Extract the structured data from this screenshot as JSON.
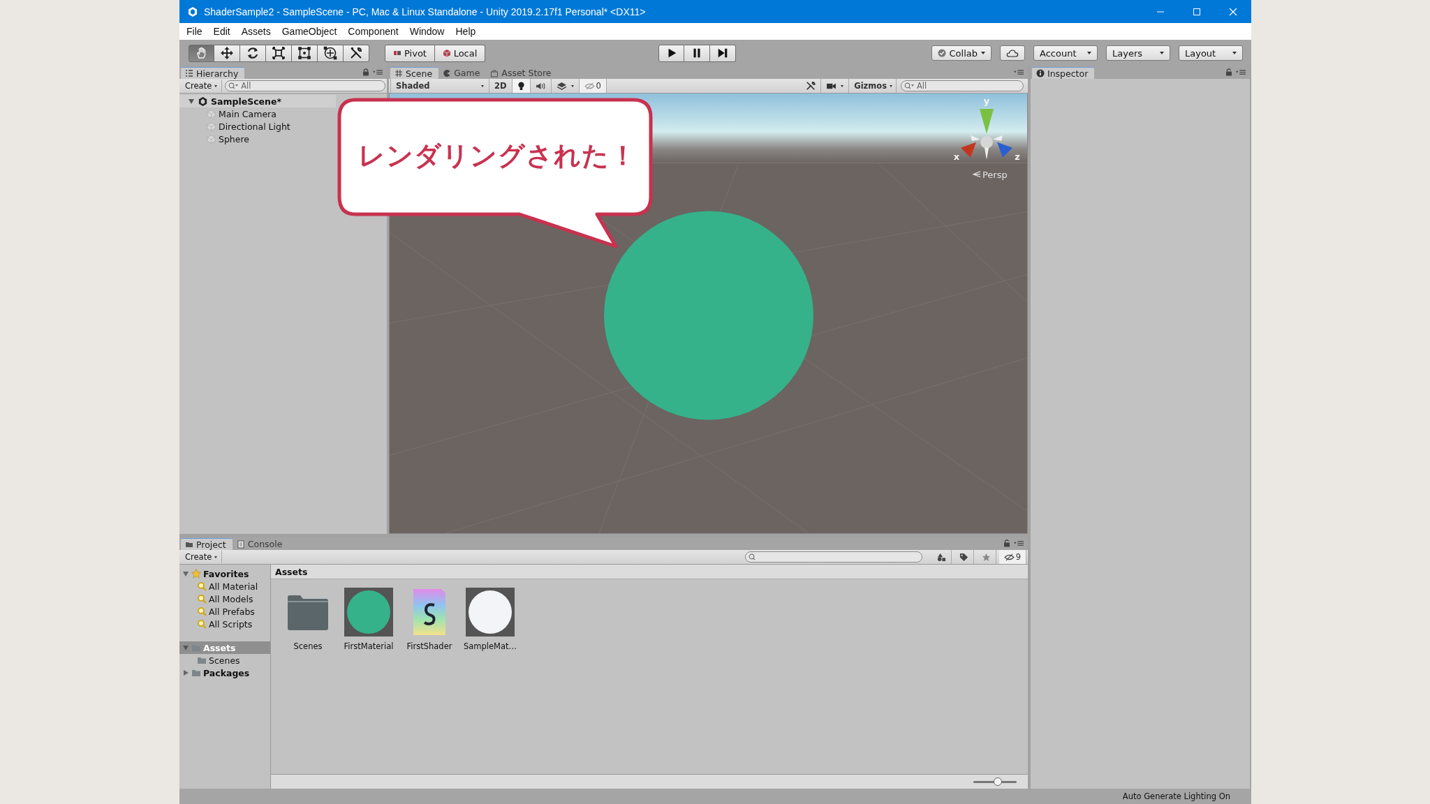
{
  "window": {
    "title": "ShaderSample2 - SampleScene - PC, Mac & Linux Standalone - Unity 2019.2.17f1 Personal* <DX11>"
  },
  "menu": [
    "File",
    "Edit",
    "Assets",
    "GameObject",
    "Component",
    "Window",
    "Help"
  ],
  "toolbar": {
    "tools": [
      {
        "kind": "hand",
        "selected": true
      },
      {
        "kind": "move",
        "selected": false
      },
      {
        "kind": "rotate",
        "selected": false
      },
      {
        "kind": "scale",
        "selected": false
      },
      {
        "kind": "rect",
        "selected": false
      },
      {
        "kind": "transform",
        "selected": false
      },
      {
        "kind": "custom",
        "selected": false
      }
    ],
    "pivot": "Pivot",
    "space": "Local",
    "collab": "Collab",
    "account": "Account",
    "layers": "Layers",
    "layout": "Layout"
  },
  "hierarchy": {
    "tab": "Hierarchy",
    "create": "Create",
    "search_placeholder": "All",
    "scene": {
      "name": "SampleScene*",
      "expanded": true,
      "children": [
        {
          "name": "Main Camera"
        },
        {
          "name": "Directional Light"
        },
        {
          "name": "Sphere"
        }
      ]
    }
  },
  "scene_view": {
    "tabs": [
      {
        "label": "Scene",
        "kind": "scene",
        "selected": true
      },
      {
        "label": "Game",
        "kind": "game",
        "selected": false
      },
      {
        "label": "Asset Store",
        "kind": "store",
        "selected": false
      }
    ],
    "shading": "Shaded",
    "mode_2d": "2D",
    "lighting_on": true,
    "audio_on": false,
    "hidden_count": "0",
    "gizmos": "Gizmos",
    "search_placeholder": "All",
    "axes": [
      "y",
      "x",
      "z"
    ],
    "projection": "Persp"
  },
  "callout": {
    "text": "レンダリングされた！"
  },
  "inspector": {
    "tab": "Inspector"
  },
  "project": {
    "tabs": [
      {
        "label": "Project",
        "kind": "project",
        "selected": true
      },
      {
        "label": "Console",
        "kind": "console",
        "selected": false
      }
    ],
    "create": "Create",
    "hidden_count": "9",
    "breadcrumb": "Assets",
    "tree": [
      {
        "label": "Favorites",
        "kind": "favorites",
        "expanded": true,
        "selected": false,
        "children": [
          {
            "label": "All Material",
            "kind": "search"
          },
          {
            "label": "All Models",
            "kind": "search"
          },
          {
            "label": "All Prefabs",
            "kind": "search"
          },
          {
            "label": "All Scripts",
            "kind": "search"
          }
        ]
      },
      {
        "label": "Assets",
        "kind": "folder",
        "expanded": true,
        "selected": true,
        "children": [
          {
            "label": "Scenes",
            "kind": "folder"
          }
        ]
      },
      {
        "label": "Packages",
        "kind": "folder",
        "expanded": false,
        "selected": false
      }
    ],
    "assets": [
      {
        "name": "Scenes",
        "kind": "folder"
      },
      {
        "name": "FirstMaterial",
        "kind": "material",
        "color": "#35b28a"
      },
      {
        "name": "FirstShader",
        "kind": "shader"
      },
      {
        "name": "SampleMat…",
        "kind": "material",
        "color": "#f2f4f8"
      }
    ],
    "zoom": {
      "level": 0.57
    }
  },
  "status_bar": {
    "text": "Auto Generate Lighting On"
  }
}
